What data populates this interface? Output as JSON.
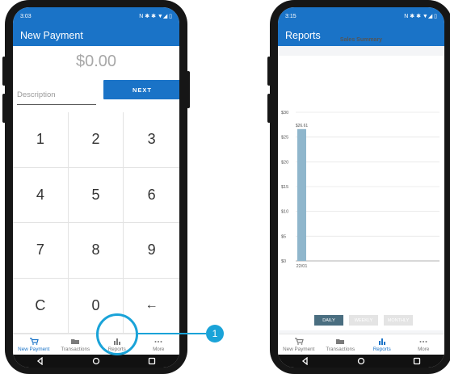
{
  "left_phone": {
    "status": {
      "time": "3:03",
      "icons_right": "N ✱ ✱ ▼◢ ▯"
    },
    "title": "New Payment",
    "amount": "$0.00",
    "description_placeholder": "Description",
    "next_label": "NEXT",
    "keys": [
      "1",
      "2",
      "3",
      "4",
      "5",
      "6",
      "7",
      "8",
      "9",
      "C",
      "0",
      "←"
    ],
    "nav": [
      {
        "label": "New Payment",
        "icon": "cart-icon",
        "active": true
      },
      {
        "label": "Transactions",
        "icon": "folder-icon",
        "active": false
      },
      {
        "label": "Reports",
        "icon": "bar-chart-icon",
        "active": false
      },
      {
        "label": "More",
        "icon": "more-dots-icon",
        "active": false
      }
    ]
  },
  "right_phone": {
    "status": {
      "time": "3:15",
      "icons_right": "N ✱ ✱ ▼◢ ▯"
    },
    "title": "Reports",
    "toggles": [
      {
        "label": "DAILY",
        "active": true
      },
      {
        "label": "WEEKLY",
        "active": false
      },
      {
        "label": "MONTHLY",
        "active": false
      }
    ],
    "nav": [
      {
        "label": "New Payment",
        "icon": "cart-icon",
        "active": false
      },
      {
        "label": "Transactions",
        "icon": "folder-icon",
        "active": false
      },
      {
        "label": "Reports",
        "icon": "bar-chart-icon",
        "active": true
      },
      {
        "label": "More",
        "icon": "more-dots-icon",
        "active": false
      }
    ]
  },
  "chart_data": {
    "type": "bar",
    "title": "Sales Summary",
    "categories": [
      "22/01"
    ],
    "values": [
      26.61
    ],
    "value_labels": [
      "$26.61"
    ],
    "ylim": [
      0,
      30
    ],
    "yticks": [
      "$0",
      "$5",
      "$10",
      "$15",
      "$20",
      "$25",
      "$30"
    ],
    "grid": true,
    "bar_color": "#8fb6cc"
  },
  "callout": {
    "number": "1"
  },
  "colors": {
    "primary": "#1a73c7",
    "callout": "#1aa3d8",
    "toggle_active": "#4a6e80",
    "toggle_inactive": "#e4e4e4"
  }
}
